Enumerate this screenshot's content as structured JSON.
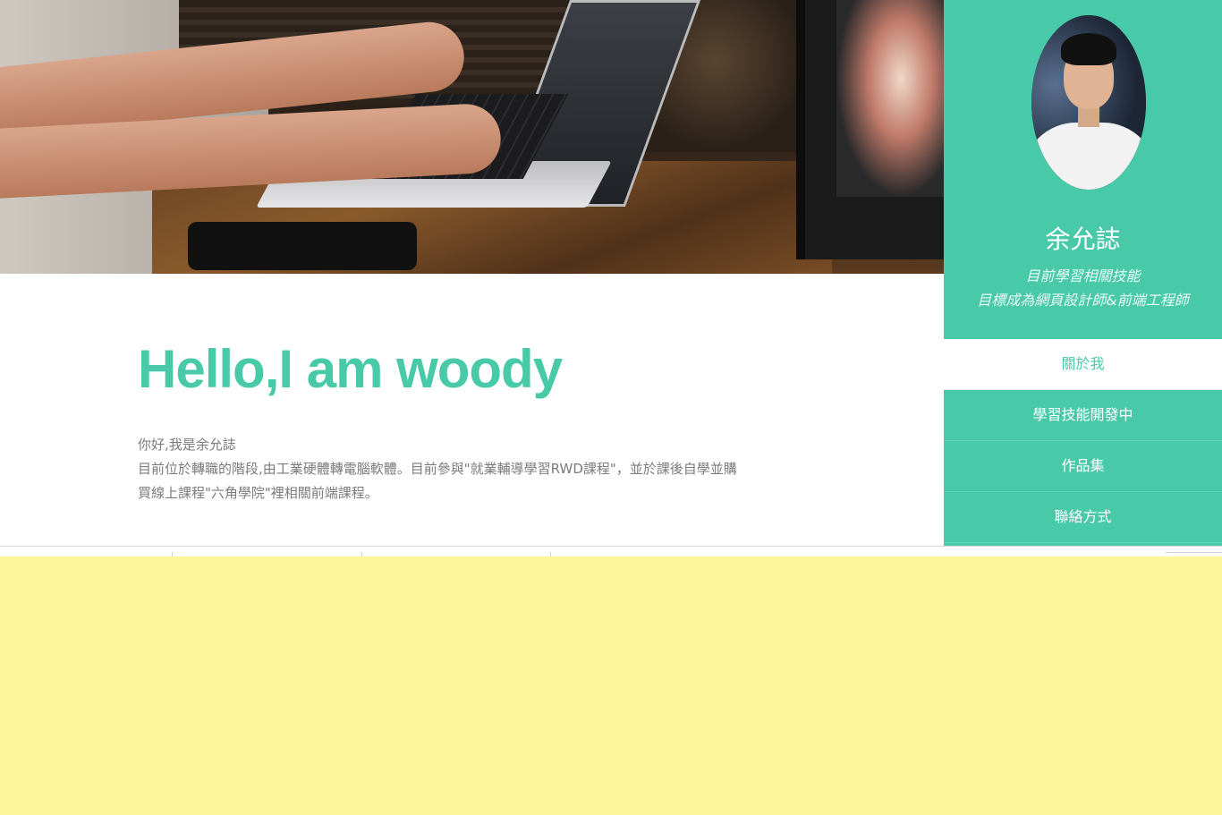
{
  "sidebar": {
    "profile": {
      "name": "余允誌",
      "desc_line1": "目前學習相關技能",
      "desc_line2": "目標成為網頁設計師&前端工程師"
    },
    "nav": [
      {
        "label": "關於我",
        "active": true
      },
      {
        "label": "學習技能開發中",
        "active": false
      },
      {
        "label": "作品集",
        "active": false
      },
      {
        "label": "聯絡方式",
        "active": false
      }
    ]
  },
  "main": {
    "title": "Hello,I am woody",
    "intro": [
      "你好,我是余允誌",
      "目前位於轉職的階段,由工業硬體轉電腦軟體。目前參與\"就業輔導學習RWD課程\"，並於課後自學並購",
      "買線上課程\"六角學院\"裡相關前端課程。"
    ]
  },
  "colors": {
    "accent": "#48c9a8",
    "bottom_background": "#fff59a",
    "text": "#7b7b7b"
  }
}
